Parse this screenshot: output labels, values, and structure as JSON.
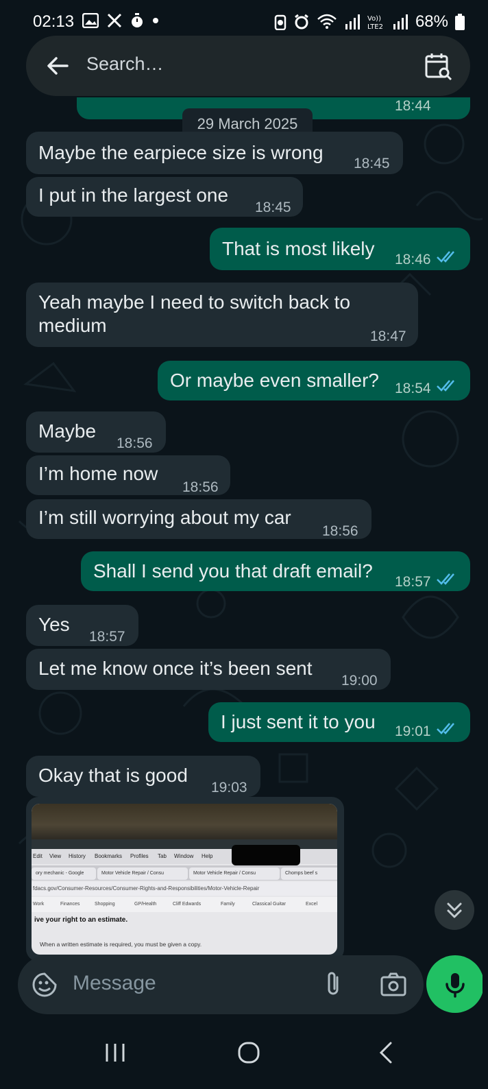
{
  "status_bar": {
    "time": "02:13",
    "battery": "68%",
    "left_icons": [
      "gallery-icon",
      "x-logo-icon",
      "stopwatch-icon",
      "dot-icon"
    ],
    "right_icons": [
      "battery-saver-icon",
      "alarm-icon",
      "wifi-icon",
      "signal-icon",
      "volte-lte2-icon",
      "signal-icon",
      "battery-icon"
    ]
  },
  "header": {
    "search_placeholder": "Search…"
  },
  "chat": {
    "date_separator": "29 March 2025",
    "partial_top_time": "18:44",
    "messages": [
      {
        "dir": "in",
        "text": "Maybe the earpiece size is wrong",
        "time": "18:45"
      },
      {
        "dir": "in",
        "text": "I put in the largest one",
        "time": "18:45"
      },
      {
        "dir": "out",
        "text": "That is most likely",
        "time": "18:46",
        "status": "read"
      },
      {
        "dir": "in",
        "text_line1": "Yeah maybe I need to switch back to",
        "text_line2": "medium",
        "time": "18:47"
      },
      {
        "dir": "out",
        "text": "Or maybe even smaller?",
        "time": "18:54",
        "status": "read"
      },
      {
        "dir": "in",
        "text": "Maybe",
        "time": "18:56"
      },
      {
        "dir": "in",
        "text": "I’m home now",
        "time": "18:56"
      },
      {
        "dir": "in",
        "text": "I’m still worrying about my car",
        "time": "18:56"
      },
      {
        "dir": "out",
        "text": "Shall I send you that draft email?",
        "time": "18:57",
        "status": "read"
      },
      {
        "dir": "in",
        "text": "Yes",
        "time": "18:57"
      },
      {
        "dir": "in",
        "text": "Let me know once it’s been sent",
        "time": "19:00"
      },
      {
        "dir": "out",
        "text": "I just sent it to you",
        "time": "19:01",
        "status": "read"
      },
      {
        "dir": "in",
        "text": "Okay that is good",
        "time": "19:03"
      }
    ],
    "image_message": {
      "menu": [
        "Edit",
        "View",
        "History",
        "Bookmarks",
        "Profiles",
        "Tab",
        "Window",
        "Help"
      ],
      "tabs": [
        "ory mechanic - Google",
        "Motor Vehicle Repair / Consu",
        "Motor Vehicle Repair / Consu",
        "Chomps beef s"
      ],
      "url": "fdacs.gov/Consumer-Resources/Consumer-Rights-and-Responsibilities/Motor-Vehicle-Repair",
      "bookmarks": [
        "Work",
        "Finances",
        "Shopping",
        "GP/Health",
        "Cliff Edwards",
        "Family",
        "Classical Guitar",
        "Excel"
      ],
      "heading": "ive your right to an estimate.",
      "body": "When a written estimate is required, you must be given a copy."
    }
  },
  "composer": {
    "placeholder": "Message"
  },
  "colors": {
    "background": "#0b141a",
    "incoming_bubble": "#202c33",
    "outgoing_bubble": "#005c4b",
    "read_tick": "#53bdeb",
    "mic_button": "#21c063"
  }
}
